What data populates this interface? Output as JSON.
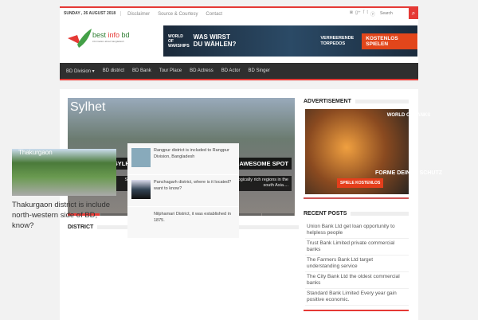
{
  "topbar": {
    "date": "SUNDAY , 26 AUGUST 2018",
    "links": [
      "Disclaimer",
      "Source & Courtesy",
      "Contact"
    ],
    "search_placeholder": "Search"
  },
  "logo": {
    "name_a": "best ",
    "name_b": "info",
    "name_c": " bd",
    "tagline": "information about bangladesh"
  },
  "header_ad": {
    "brand": "WORLD OF WARSHIPS",
    "headline": "WAS WIRST DU WÄHLEN?",
    "sub": "VERHEERENDE TORPEDOS",
    "cta": "KOSTENLOS SPIELEN"
  },
  "nav": {
    "items": [
      "BD Division ▾",
      "BD district",
      "BD Bank",
      "Tour Place",
      "BD Actress",
      "BD Actor",
      "BD Singer"
    ]
  },
  "slider": {
    "city": "Sylhet",
    "title": "SYLHET DIVISION IS VERY FASCINATING & AWESOME SPOT",
    "excerpt": "Sylhet Division is one of the most fascinating and archaeologically rich regions in the south Asia....",
    "active_slide": 1,
    "total_slides": 7
  },
  "district": {
    "heading": "DISTRICT",
    "featured": {
      "img_label": "Thakurgaon",
      "title": "Thakurgaon district is include north-western side of BD, know?"
    },
    "posts": [
      "Rangpur district is included to Rangpur Division, Bangladesh",
      "Panchagarh district, where is it located? want to know?",
      "Nilphamari District, it was established in 1875."
    ]
  },
  "sidebar": {
    "ad_heading": "ADVERTISEMENT",
    "ad": {
      "brand": "WORLD OF TANKS",
      "headline": "FORME DEINEN SCHUTZ",
      "cta": "SPIELE KOSTENLOS"
    },
    "recent_heading": "RECENT POSTS",
    "recent": [
      "Union Bank Ltd get loan opportunity to helpless people",
      "Trust Bank Limited private commercial banks",
      "The Farmers Bank Ltd target understanding service",
      "The City Bank Ltd the oldest commercial banks",
      "Standard Bank Limited Every year gain positive economic."
    ]
  }
}
